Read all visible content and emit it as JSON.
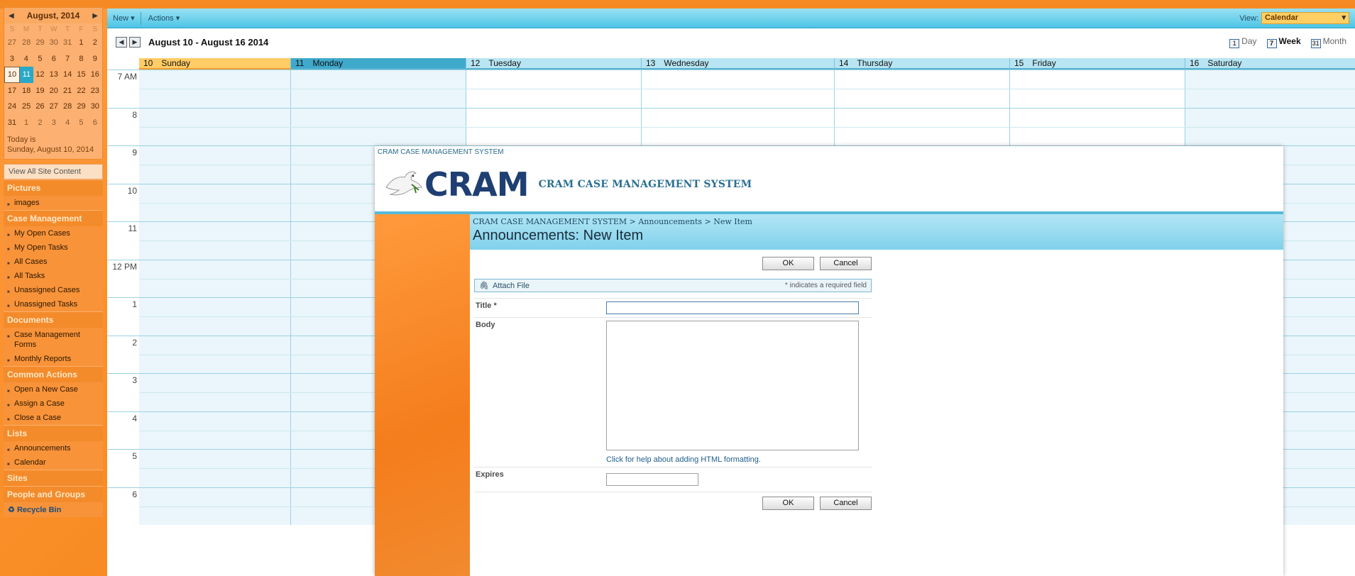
{
  "mini_calendar": {
    "title": "August, 2014",
    "weekdays": [
      "S",
      "M",
      "T",
      "W",
      "T",
      "F",
      "S"
    ],
    "weeks": [
      [
        "27",
        "28",
        "29",
        "30",
        "31",
        "1",
        "2"
      ],
      [
        "3",
        "4",
        "5",
        "6",
        "7",
        "8",
        "9"
      ],
      [
        "10",
        "11",
        "12",
        "13",
        "14",
        "15",
        "16"
      ],
      [
        "17",
        "18",
        "19",
        "20",
        "21",
        "22",
        "23"
      ],
      [
        "24",
        "25",
        "26",
        "27",
        "28",
        "29",
        "30"
      ],
      [
        "31",
        "1",
        "2",
        "3",
        "4",
        "5",
        "6"
      ]
    ],
    "today_label": "Today is",
    "today_date": "Sunday, August 10, 2014"
  },
  "nav": {
    "view_all": "View All Site Content",
    "sections": [
      {
        "heading": "Pictures",
        "items": [
          "images"
        ]
      },
      {
        "heading": "Case Management",
        "items": [
          "My Open Cases",
          "My Open Tasks",
          "All Cases",
          "All Tasks",
          "Unassigned Cases",
          "Unassigned Tasks"
        ]
      },
      {
        "heading": "Documents",
        "items": [
          "Case Management Forms",
          "Monthly Reports"
        ]
      },
      {
        "heading": "Common Actions",
        "items": [
          "Open a New Case",
          "Assign a Case",
          "Close a Case"
        ]
      },
      {
        "heading": "Lists",
        "items": [
          "Announcements",
          "Calendar"
        ]
      },
      {
        "heading": "Sites",
        "items": []
      },
      {
        "heading": "People and Groups",
        "items": []
      }
    ],
    "recycle_bin": "Recycle Bin"
  },
  "ribbon": {
    "new_label": "New",
    "actions_label": "Actions",
    "view_label": "View:",
    "view_value": "Calendar"
  },
  "calendar": {
    "range": "August 10 - August 16 2014",
    "view_day": "Day",
    "view_week": "Week",
    "view_month": "Month",
    "days": [
      {
        "num": "10",
        "name": "Sunday"
      },
      {
        "num": "11",
        "name": "Monday"
      },
      {
        "num": "12",
        "name": "Tuesday"
      },
      {
        "num": "13",
        "name": "Wednesday"
      },
      {
        "num": "14",
        "name": "Thursday"
      },
      {
        "num": "15",
        "name": "Friday"
      },
      {
        "num": "16",
        "name": "Saturday"
      }
    ],
    "hours": [
      "7 AM",
      "8",
      "9",
      "10",
      "11",
      "12 PM",
      "1",
      "2",
      "3",
      "4",
      "5",
      "6"
    ]
  },
  "dialog": {
    "top_label": "CRAM CASE MANAGEMENT SYSTEM",
    "logo_word": "CRAM",
    "brand_title": "CRAM CASE MANAGEMENT SYSTEM",
    "breadcrumb": "CRAM CASE MANAGEMENT SYSTEM > Announcements > New Item",
    "page_title": "Announcements: New Item",
    "ok_label": "OK",
    "cancel_label": "Cancel",
    "attach_label": "Attach File",
    "required_note": "* indicates a required field",
    "title_label": "Title *",
    "title_value": "",
    "body_label": "Body",
    "body_value": "",
    "help_link": "Click for help about adding HTML formatting.",
    "expires_label": "Expires",
    "expires_value": ""
  }
}
